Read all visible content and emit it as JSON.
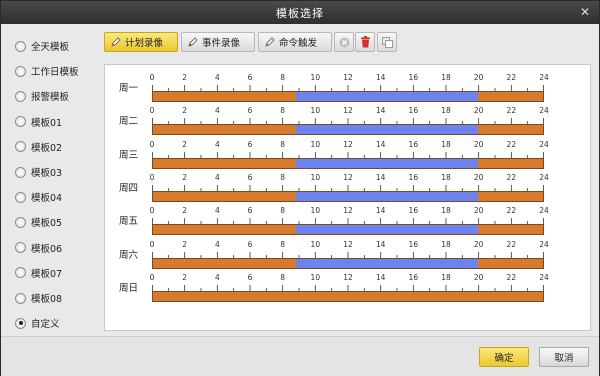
{
  "window": {
    "title": "模板选择"
  },
  "templates": [
    {
      "label": "全天模板",
      "selected": false
    },
    {
      "label": "工作日模板",
      "selected": false
    },
    {
      "label": "报警模板",
      "selected": false
    },
    {
      "label": "模板01",
      "selected": false
    },
    {
      "label": "模板02",
      "selected": false
    },
    {
      "label": "模板03",
      "selected": false
    },
    {
      "label": "模板04",
      "selected": false
    },
    {
      "label": "模板05",
      "selected": false
    },
    {
      "label": "模板06",
      "selected": false
    },
    {
      "label": "模板07",
      "selected": false
    },
    {
      "label": "模板08",
      "selected": false
    },
    {
      "label": "自定义",
      "selected": true
    }
  ],
  "toolbar": {
    "scheduled_record": "计划录像",
    "event_record": "事件录像",
    "command_trigger": "命令触发",
    "scheduled_color": "#d67a2e",
    "event_color": "#6c83f0"
  },
  "schedule": {
    "ticks": [
      "0",
      "2",
      "4",
      "6",
      "8",
      "10",
      "12",
      "14",
      "16",
      "18",
      "20",
      "22",
      "24"
    ],
    "days": [
      {
        "label": "周一",
        "segments": [
          {
            "start": 0,
            "end": 8.8,
            "type": "scheduled"
          },
          {
            "start": 8.8,
            "end": 20,
            "type": "event"
          },
          {
            "start": 20,
            "end": 24,
            "type": "scheduled"
          }
        ]
      },
      {
        "label": "周二",
        "segments": [
          {
            "start": 0,
            "end": 8.8,
            "type": "scheduled"
          },
          {
            "start": 8.8,
            "end": 20,
            "type": "event"
          },
          {
            "start": 20,
            "end": 24,
            "type": "scheduled"
          }
        ]
      },
      {
        "label": "周三",
        "segments": [
          {
            "start": 0,
            "end": 8.8,
            "type": "scheduled"
          },
          {
            "start": 8.8,
            "end": 20,
            "type": "event"
          },
          {
            "start": 20,
            "end": 24,
            "type": "scheduled"
          }
        ]
      },
      {
        "label": "周四",
        "segments": [
          {
            "start": 0,
            "end": 8.8,
            "type": "scheduled"
          },
          {
            "start": 8.8,
            "end": 20,
            "type": "event"
          },
          {
            "start": 20,
            "end": 24,
            "type": "scheduled"
          }
        ]
      },
      {
        "label": "周五",
        "segments": [
          {
            "start": 0,
            "end": 8.8,
            "type": "scheduled"
          },
          {
            "start": 8.8,
            "end": 20,
            "type": "event"
          },
          {
            "start": 20,
            "end": 24,
            "type": "scheduled"
          }
        ]
      },
      {
        "label": "周六",
        "segments": [
          {
            "start": 0,
            "end": 8.8,
            "type": "scheduled"
          },
          {
            "start": 8.8,
            "end": 20,
            "type": "event"
          },
          {
            "start": 20,
            "end": 24,
            "type": "scheduled"
          }
        ]
      },
      {
        "label": "周日",
        "segments": [
          {
            "start": 0,
            "end": 24,
            "type": "scheduled"
          }
        ]
      }
    ]
  },
  "footer": {
    "ok": "确定",
    "cancel": "取消"
  }
}
